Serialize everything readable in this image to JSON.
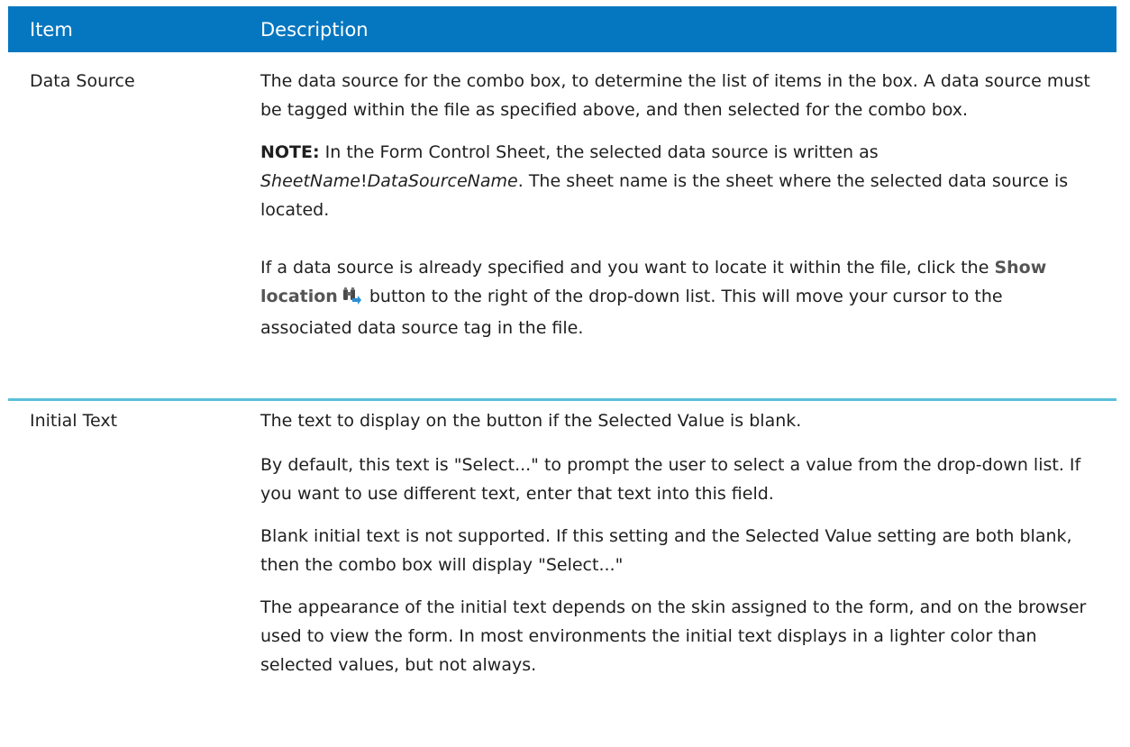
{
  "header": {
    "col_item": "Item",
    "col_description": "Description"
  },
  "rows": [
    {
      "item": "Data Source",
      "p1": "The data source for the combo box, to determine the list of items in the box. A data source must be tagged within the file as specified above, and then selected for the combo box.",
      "note_label": "NOTE:",
      "note_prefix": " In the Form Control Sheet, the selected data source is written as ",
      "note_sheetname": "SheetName",
      "note_bang": "!",
      "note_dsname": "DataSourceName",
      "note_suffix": ". The sheet name is the sheet where the selected data source is located.",
      "p3_prefix": "If a data source is already specified and you want to locate it within the file, click the ",
      "p3_button": "Show location",
      "p3_suffix": " button to the right of the drop-down list. This will move your cursor to the associated data source tag in the file.",
      "icon": "binoculars-icon"
    },
    {
      "item": "Initial Text",
      "p1": "The text to display on the button if the Selected Value is blank.",
      "p2": "By default, this text is \"Select...\" to prompt the user to select a value from the drop-down list. If you want to use different text, enter that text into this field.",
      "p3": "Blank initial text is not supported. If this setting and the Selected Value setting are both blank, then the combo box will display \"Select...\"",
      "p4": "The appearance of the initial text depends on the skin assigned to the form, and on the browser used to view the form. In most environments the initial text displays in a lighter color than selected values, but not always."
    }
  ],
  "colors": {
    "header_bg": "#0577c0",
    "row_divider": "#5bbfd9"
  }
}
